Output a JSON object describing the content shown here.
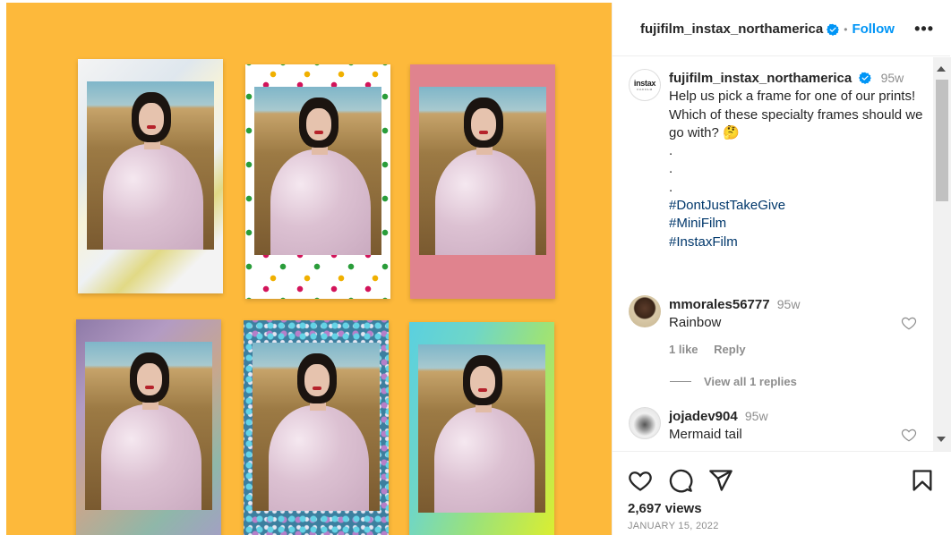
{
  "media": {
    "frames": [
      {
        "style": "marble"
      },
      {
        "style": "polka-dots"
      },
      {
        "style": "pink"
      },
      {
        "style": "holographic"
      },
      {
        "style": "glitter"
      },
      {
        "style": "rainbow-gradient"
      }
    ],
    "background_color": "#fdb93b"
  },
  "header": {
    "username": "fujifilm_instax_northamerica",
    "separator": "•",
    "follow_label": "Follow",
    "more_label": "•••"
  },
  "caption": {
    "avatar_text": "instax",
    "avatar_subtext": "FUJIFILM",
    "username": "fujifilm_instax_northamerica",
    "time": "95w",
    "text": "Help us pick a frame for one of our prints! Which of these specialty frames should we go with? 🤔",
    "dots": [
      ".",
      ".",
      "."
    ],
    "hashtags": [
      "#DontJustTakeGive",
      "#MiniFilm",
      "#InstaxFilm"
    ]
  },
  "comments": [
    {
      "username": "mmorales56777",
      "time": "95w",
      "text": "Rainbow",
      "likes": "1 like",
      "reply_label": "Reply"
    },
    {
      "username": "jojadev904",
      "time": "95w",
      "text": "Mermaid tail"
    }
  ],
  "view_replies_label": "View all 1 replies",
  "footer": {
    "views": "2,697 views",
    "date": "JANUARY 15, 2022"
  },
  "colors": {
    "link_blue": "#0095f6",
    "hashtag_blue": "#00376b",
    "secondary_text": "#8e8e8e",
    "verified_blue": "#0095f6"
  },
  "icons": [
    "verified-badge-icon",
    "more-options-icon",
    "heart-icon",
    "comment-icon",
    "share-icon",
    "bookmark-icon"
  ]
}
